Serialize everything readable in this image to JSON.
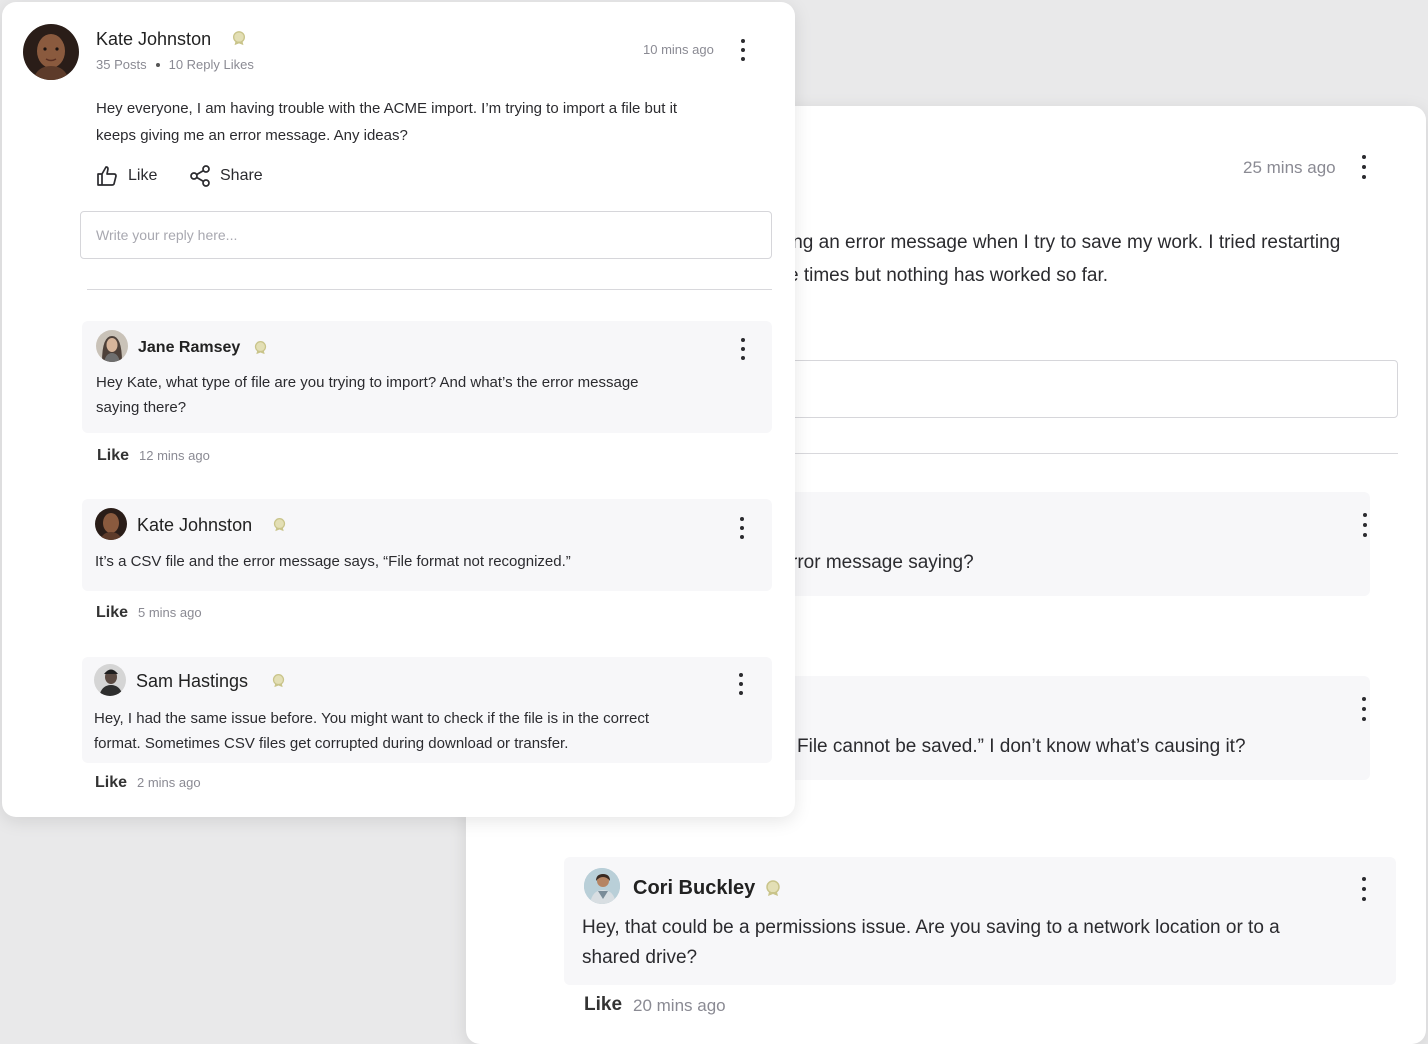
{
  "back_card": {
    "post": {
      "time": "25 mins ago",
      "body_line1": "ing an error message when I try to save my work. I tried restarting",
      "body_line2": "e times but nothing has worked so far."
    },
    "replies": [
      {
        "text": "rror message saying?"
      },
      {
        "text": "File cannot be saved.” I don’t know what’s causing it?"
      },
      {
        "author": "Cori Buckley",
        "text_line1": "Hey, that could be a permissions issue. Are you saving to a network location or to a",
        "text_line2": "shared drive?",
        "like_label": "Like",
        "time": "20 mins ago"
      }
    ]
  },
  "front_card": {
    "post": {
      "author": "Kate Johnston",
      "posts": "35 Posts",
      "reply_likes": "10 Reply Likes",
      "time": "10 mins ago",
      "body_line1": "Hey everyone, I am having trouble with the ACME import. I’m trying to import a file but it",
      "body_line2": "keeps giving me an error message. Any ideas?",
      "like_label": "Like",
      "share_label": "Share",
      "reply_placeholder": "Write your reply here..."
    },
    "replies": [
      {
        "author": "Jane Ramsey",
        "text_line1": "Hey Kate, what type of file are you trying to import? And what’s the error message",
        "text_line2": "saying there?",
        "like_label": "Like",
        "time": "12 mins ago"
      },
      {
        "author": "Kate Johnston",
        "text_line1": "It’s a CSV file and the error message says, “File format not recognized.”",
        "like_label": "Like",
        "time": "5 mins ago"
      },
      {
        "author": "Sam Hastings",
        "text_line1": "Hey, I had the same issue before. You might want to check if the file is in the correct",
        "text_line2": "format. Sometimes CSV files get corrupted during download or transfer.",
        "like_label": "Like",
        "time": "2 mins ago"
      }
    ]
  },
  "colors": {
    "background": "#e9e9ea",
    "card": "#ffffff",
    "reply_background": "#f7f7f9",
    "badge": "#c9c48a",
    "muted_text": "#8a8a93"
  },
  "icons": [
    "badge-icon",
    "more-options-icon",
    "thumbs-up-icon",
    "share-icon"
  ]
}
